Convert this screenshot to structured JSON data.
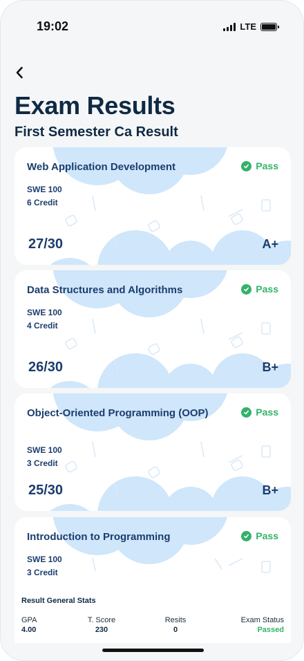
{
  "status_bar": {
    "time": "19:02",
    "network": "LTE"
  },
  "header": {
    "title": "Exam Results",
    "subtitle": "First Semester Ca Result"
  },
  "colors": {
    "primary": "#1b3d6d",
    "pass": "#33b26a",
    "cloud": "#cfe6fb"
  },
  "icons": {
    "back": "chevron-left-icon",
    "pass": "check-circle-icon"
  },
  "courses": [
    {
      "title": "Web Application Development",
      "status": "Pass",
      "code": "SWE 100",
      "credit": "6 Credit",
      "score": "27/30",
      "grade": "A+"
    },
    {
      "title": "Data Structures and Algorithms",
      "status": "Pass",
      "code": "SWE 100",
      "credit": "4 Credit",
      "score": "26/30",
      "grade": "B+"
    },
    {
      "title": "Object-Oriented Programming (OOP)",
      "status": "Pass",
      "code": "SWE 100",
      "credit": "3 Credit",
      "score": "25/30",
      "grade": "B+"
    },
    {
      "title": "Introduction to Programming",
      "status": "Pass",
      "code": "SWE 100",
      "credit": "3 Credit",
      "score": "",
      "grade": ""
    }
  ],
  "stats": {
    "title": "Result General Stats",
    "gpa_label": "GPA",
    "gpa": "4.00",
    "score_label": "T. Score",
    "score": "230",
    "resits_label": "Resits",
    "resits": "0",
    "exam_status_label": "Exam Status",
    "exam_status": "Passed"
  }
}
